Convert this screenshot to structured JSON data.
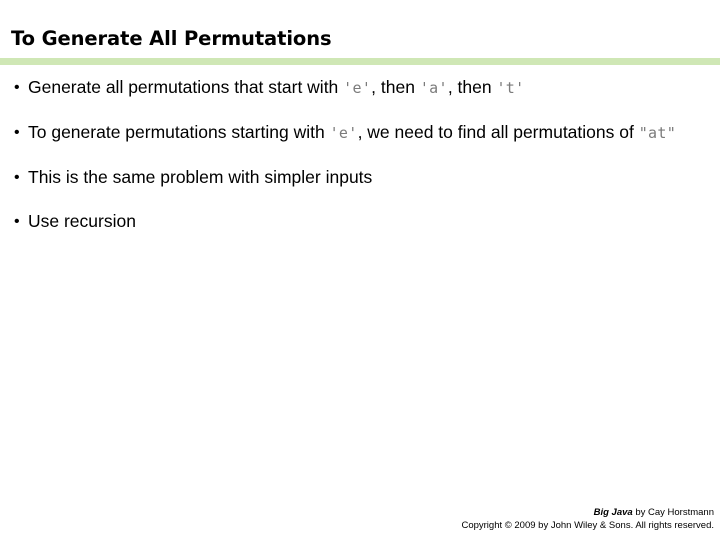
{
  "slide": {
    "title": "To Generate All Permutations",
    "accent_color": "#cfe7b5",
    "code_color": "#7b7b7b",
    "bullet_marker": "•",
    "bullets": [
      {
        "marker": "•",
        "segments": [
          {
            "type": "text",
            "value": "Generate all permutations that start with "
          },
          {
            "type": "code",
            "value": "'e'"
          },
          {
            "type": "text",
            "value": ", then "
          },
          {
            "type": "code",
            "value": "'a'"
          },
          {
            "type": "text",
            "value": ", then "
          },
          {
            "type": "code",
            "value": "'t'"
          }
        ]
      },
      {
        "marker": "•",
        "segments": [
          {
            "type": "text",
            "value": "To generate permutations starting with "
          },
          {
            "type": "code",
            "value": "'e'"
          },
          {
            "type": "text",
            "value": ", we need to find all permutations of "
          },
          {
            "type": "code",
            "value": "\"at\""
          }
        ]
      },
      {
        "marker": "•",
        "segments": [
          {
            "type": "text",
            "value": "This is the same problem with simpler inputs"
          }
        ]
      },
      {
        "marker": "•",
        "segments": [
          {
            "type": "text",
            "value": "Use recursion"
          }
        ]
      }
    ]
  },
  "footer": {
    "book_title": "Big Java",
    "byline": " by Cay Horstmann",
    "copyright": "Copyright © 2009 by John Wiley & Sons.  All rights reserved."
  }
}
